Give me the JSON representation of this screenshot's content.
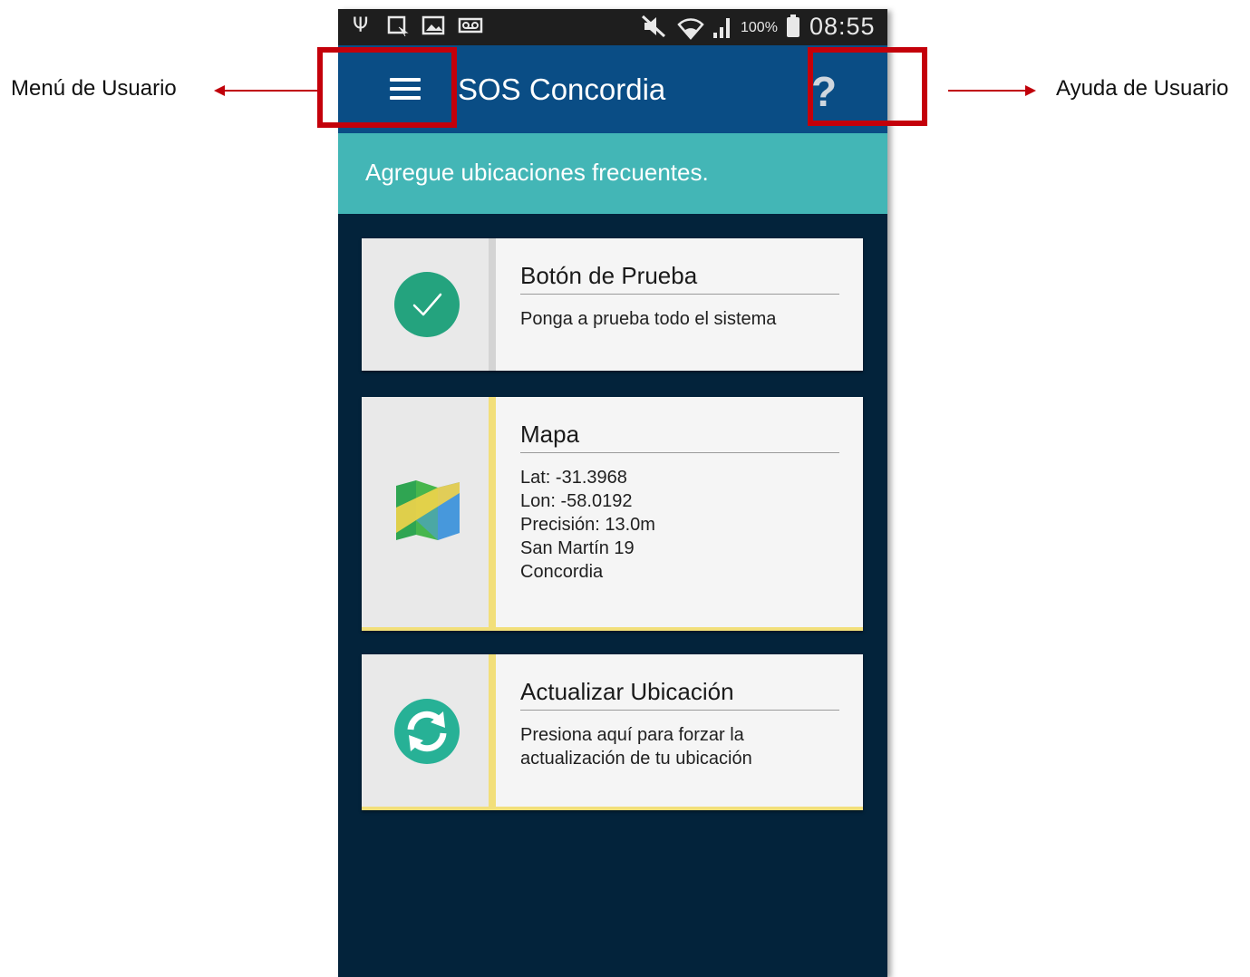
{
  "annotations": {
    "menu_label": "Menú de Usuario",
    "help_label": "Ayuda de Usuario",
    "highlight_color": "#c4000a"
  },
  "status_bar": {
    "battery_percent": "100%",
    "time": "08:55",
    "icons": [
      "usb-icon",
      "screenshot-icon",
      "gallery-icon",
      "voicemail-icon",
      "mute-icon",
      "wifi-icon",
      "signal-icon",
      "battery-charging-icon"
    ]
  },
  "app_bar": {
    "title": "SOS Concordia",
    "menu_icon": "hamburger-menu-icon",
    "help_symbol": "?",
    "color": "#0a4d85"
  },
  "banner": {
    "text": "Agregue ubicaciones frecuentes.",
    "color": "#43b6b6"
  },
  "cards": [
    {
      "title": "Botón de Prueba",
      "description": [
        "Ponga a prueba todo el sistema"
      ],
      "icon": "check-circle-icon"
    },
    {
      "title": "Mapa",
      "description": [
        "Lat: -31.3968",
        "Lon: -58.0192",
        "Precisión: 13.0m",
        "San Martín 19",
        "Concordia"
      ],
      "icon": "map-icon"
    },
    {
      "title": "Actualizar Ubicación",
      "description": [
        "Presiona aquí para forzar la",
        "actualización de tu ubicación"
      ],
      "icon": "refresh-icon"
    }
  ],
  "background_color": "#03233b"
}
